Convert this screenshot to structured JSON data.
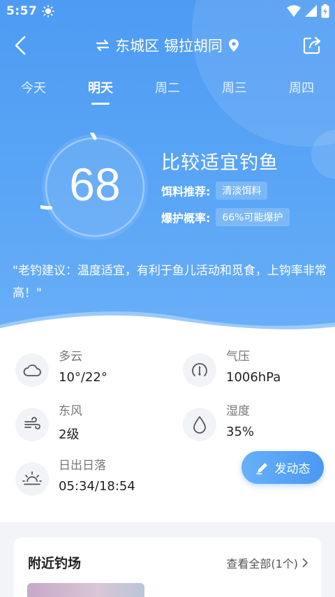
{
  "status": {
    "time": "5:57"
  },
  "header": {
    "location": "东城区 锡拉胡同"
  },
  "tabs": [
    {
      "label": "今天"
    },
    {
      "label": "明天"
    },
    {
      "label": "周二"
    },
    {
      "label": "周三"
    },
    {
      "label": "周四"
    }
  ],
  "active_tab": "明天",
  "score": {
    "value": "68",
    "fraction": 0.68
  },
  "rating": {
    "title": "比较适宜钓鱼",
    "bait_label": "饵料推荐:",
    "bait_value": "清淡饵料",
    "burst_label": "爆护概率:",
    "burst_value": "66%可能爆护"
  },
  "advice": "\"老钓建议：温度适宜，有利于鱼儿活动和觅食，上钩率非常高！\"",
  "weather": {
    "sky_label": "多云",
    "sky_value": "10°/22°",
    "pressure_label": "气压",
    "pressure_value": "1006hPa",
    "wind_label": "东风",
    "wind_value": "2级",
    "humidity_label": "湿度",
    "humidity_value": "35%",
    "sun_label": "日出日落",
    "sun_value": "05:34/18:54"
  },
  "post_button": "发动态",
  "nearby": {
    "title": "附近钓场",
    "more": "查看全部(1个)"
  },
  "colors": {
    "primary": "#4d9bf3",
    "accent_light": "#6aaff7"
  }
}
